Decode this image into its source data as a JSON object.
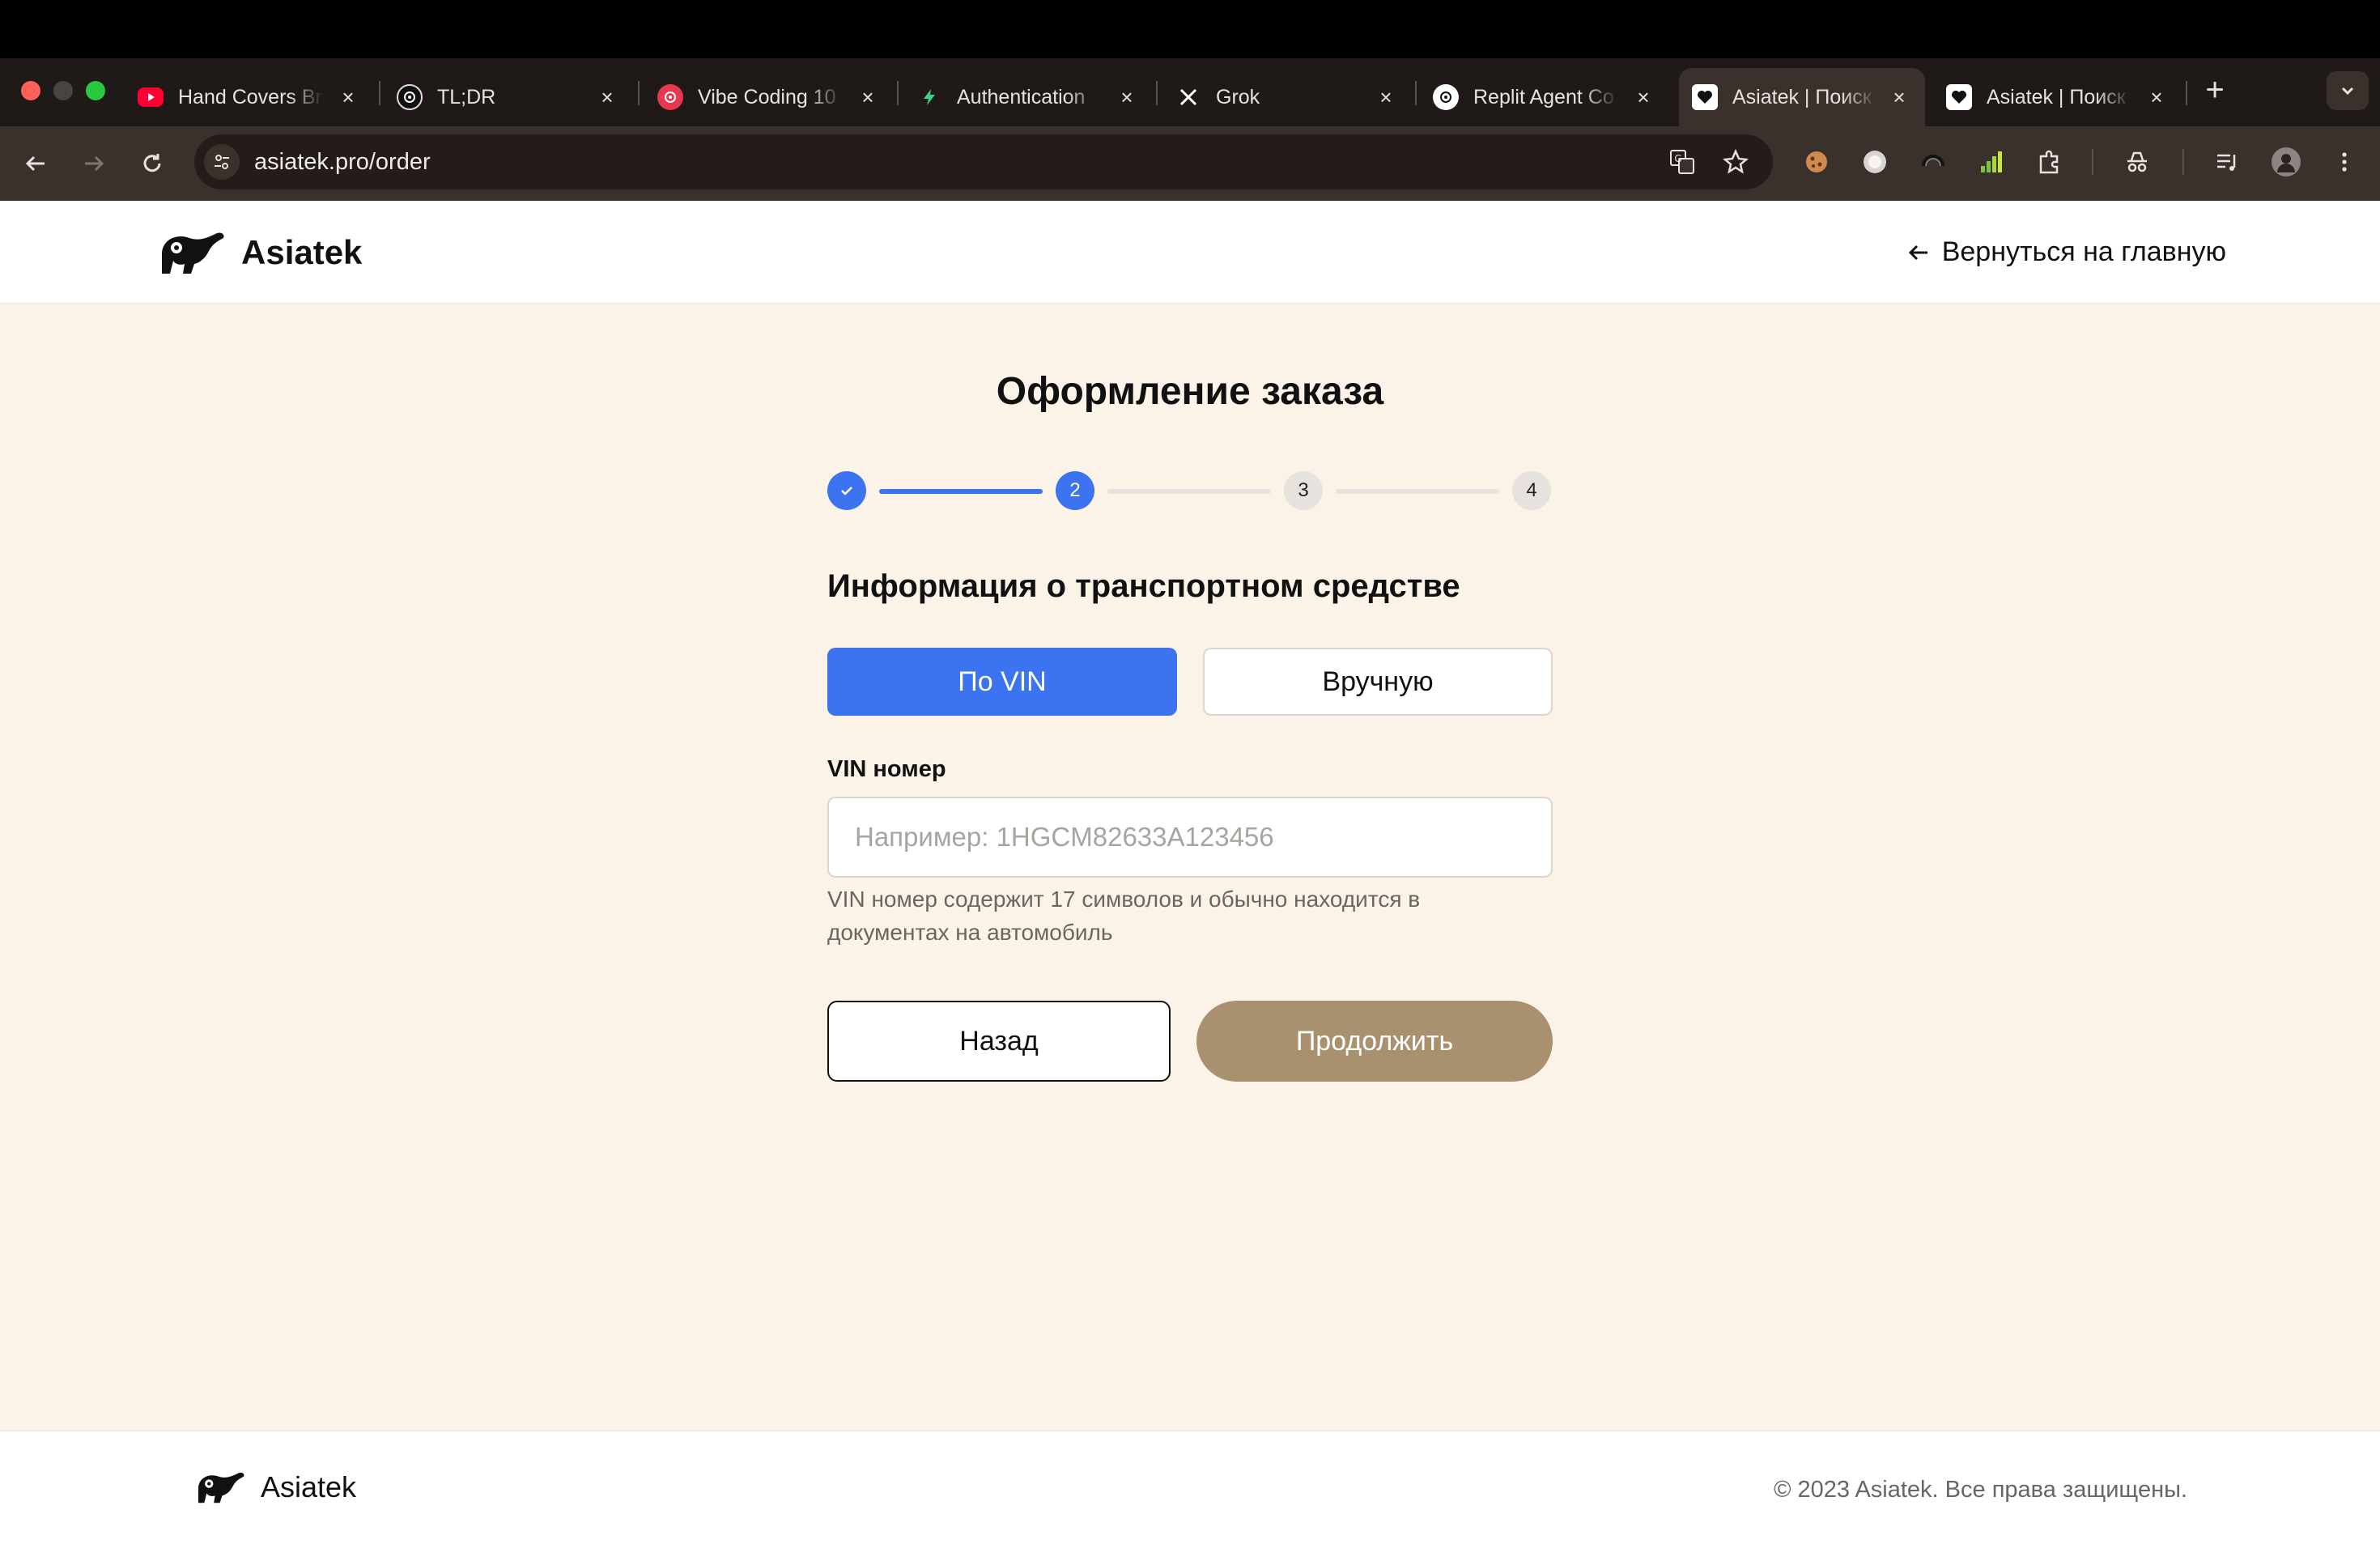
{
  "browser": {
    "tabs": [
      {
        "title": "Hand Covers Br",
        "favicon": "youtube-icon"
      },
      {
        "title": "TL;DR",
        "favicon": "openai-icon"
      },
      {
        "title": "Vibe Coding 10",
        "favicon": "target-icon"
      },
      {
        "title": "Authentication",
        "favicon": "bolt-icon"
      },
      {
        "title": "Grok",
        "favicon": "x-icon"
      },
      {
        "title": "Replit Agent Co",
        "favicon": "openai-icon"
      },
      {
        "title": "Asiatek | Поиск",
        "favicon": "heart-icon",
        "active": true
      },
      {
        "title": "Asiatek | Поиск",
        "favicon": "heart-icon"
      }
    ],
    "url": "asiatek.pro/order"
  },
  "header": {
    "brand": "Asiatek",
    "back_link": "Вернуться на главную"
  },
  "order": {
    "title": "Оформление заказа",
    "steps": [
      {
        "label": "✓",
        "state": "done"
      },
      {
        "label": "2",
        "state": "current"
      },
      {
        "label": "3",
        "state": "todo"
      },
      {
        "label": "4",
        "state": "todo"
      }
    ],
    "section_title": "Информация о транспортном средстве",
    "mode_vin": "По VIN",
    "mode_manual": "Вручную",
    "vin_label": "VIN номер",
    "vin_value": "",
    "vin_placeholder": "Например: 1HGCM82633A123456",
    "vin_help": "VIN номер содержит 17 символов и обычно находится в документах на автомобиль",
    "back_button": "Назад",
    "continue_button": "Продолжить"
  },
  "footer": {
    "brand": "Asiatek",
    "copyright": "© 2023 Asiatek. Все права защищены."
  },
  "colors": {
    "accent": "#3b73f0",
    "continue": "#a99170",
    "page_bg": "#fcf3e8"
  }
}
